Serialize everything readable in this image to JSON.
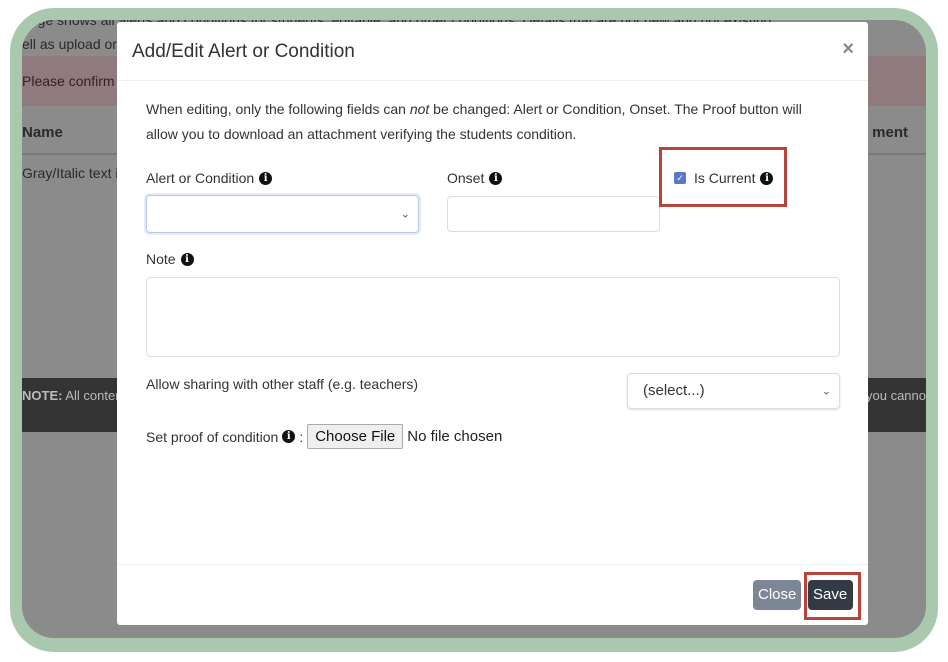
{
  "background": {
    "line1": "page shows all alerts and conditions for students, editable, and other conditions. Details that are not new and not existing",
    "line2": "ell as upload or",
    "alert_banner": "Please confirm",
    "col_name": "Name",
    "col_right": "ment",
    "row1": "Gray/Italic text i",
    "note_bold": "NOTE:",
    "note_left": " All conten",
    "note_right": "you canno"
  },
  "modal": {
    "title": "Add/Edit Alert or Condition",
    "close_symbol": "×",
    "intro_pre": "When editing, only the following fields can ",
    "intro_em": "not",
    "intro_post": " be changed: Alert or Condition, Onset. The Proof button will allow you to download an attachment verifying the students condition.",
    "alert_label": "Alert or Condition",
    "onset_label": "Onset",
    "is_current_label": "Is Current",
    "is_current_checked": true,
    "note_label": "Note",
    "sharing_label": "Allow sharing with other staff (e.g. teachers)",
    "sharing_value": "(select...)",
    "proof_label": "Set proof of condition",
    "proof_colon": ":",
    "choose_file": "Choose File",
    "no_file": "No file chosen",
    "close_button": "Close",
    "save_button": "Save"
  },
  "colors": {
    "frame": "#a9c8ae",
    "highlight": "#b7433a",
    "save": "#343a44",
    "close": "#7d8695"
  }
}
